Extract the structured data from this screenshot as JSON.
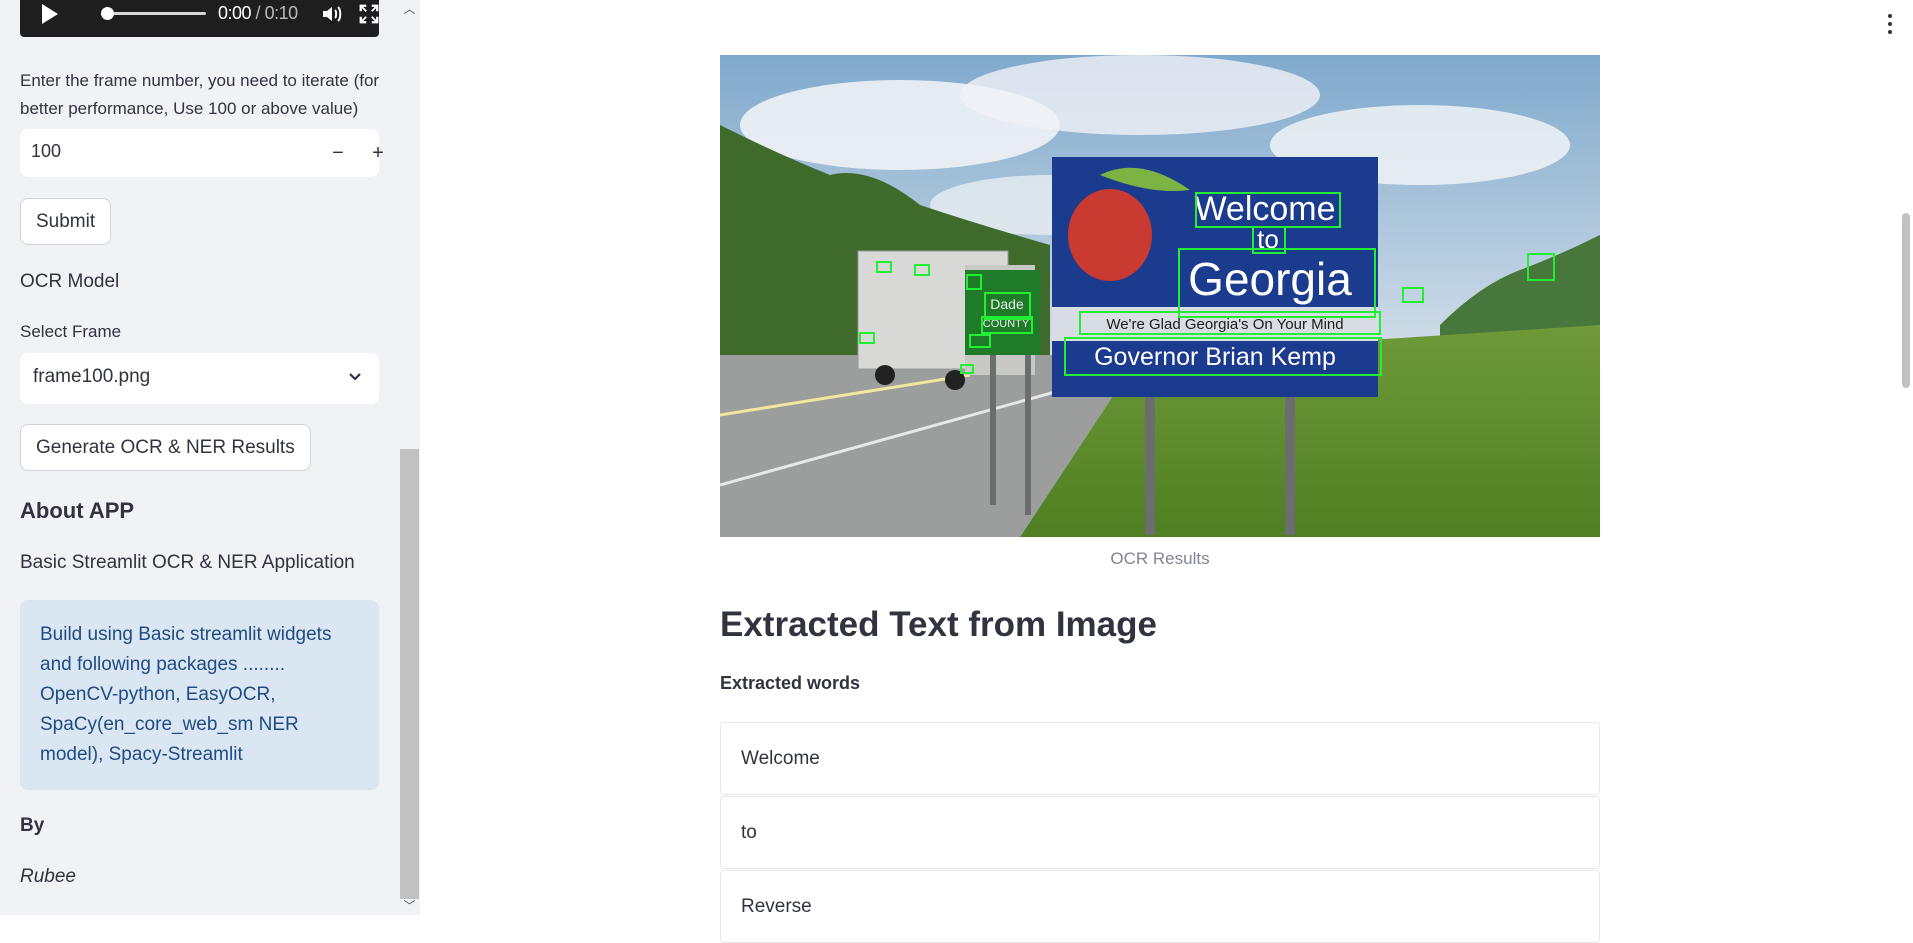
{
  "video": {
    "current_time": "0:00",
    "separator": " / ",
    "duration": "0:10"
  },
  "sidebar": {
    "frame_prompt": "Enter the frame number, you need to iterate (for better performance, Use 100 or above value)",
    "frame_number": "100",
    "submit_label": "Submit",
    "ocr_model_label": "OCR Model",
    "select_frame_label": "Select Frame",
    "selected_frame": "frame100.png",
    "generate_label": "Generate OCR & NER Results",
    "about_heading": "About APP",
    "about_text": "Basic Streamlit OCR & NER Application",
    "info_text": "Build using Basic streamlit widgets and following packages ........ OpenCV-python, EasyOCR, SpaCy(en_core_web_sm NER model), Spacy-Streamlit",
    "by_label": "By",
    "author": "Rubee"
  },
  "main": {
    "image_caption": "OCR Results",
    "sign_texts": {
      "welcome": "Welcome",
      "to": "to",
      "georgia": "Georgia",
      "slogan": "We're Glad Georgia's On Your Mind",
      "governor": "Governor Brian Kemp",
      "dade": "Dade",
      "county": "COUNTY"
    },
    "heading": "Extracted Text from Image",
    "words_heading": "Extracted words",
    "words": [
      "Welcome",
      "to",
      "Reverse"
    ]
  },
  "colors": {
    "sidebar_bg": "#f0f2f6",
    "info_bg": "#dbe6f3",
    "info_text": "#1f4c83",
    "ocr_box": "#22ee33",
    "sign_blue": "#1b3b8f"
  }
}
